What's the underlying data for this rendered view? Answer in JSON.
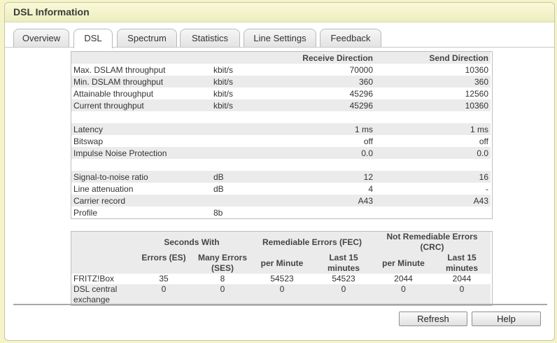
{
  "title": "DSL Information",
  "tabs": [
    "Overview",
    "DSL",
    "Spectrum",
    "Statistics",
    "Line Settings",
    "Feedback"
  ],
  "active_tab": "DSL",
  "line_table": {
    "headers": [
      "",
      "",
      "Receive Direction",
      "Send Direction"
    ],
    "rows": [
      {
        "label": "Max. DSLAM throughput",
        "unit": "kbit/s",
        "receive": "70000",
        "send": "10360"
      },
      {
        "label": "Min. DSLAM throughput",
        "unit": "kbit/s",
        "receive": "360",
        "send": "360"
      },
      {
        "label": "Attainable throughput",
        "unit": "kbit/s",
        "receive": "45296",
        "send": "12560"
      },
      {
        "label": "Current throughput",
        "unit": "kbit/s",
        "receive": "45296",
        "send": "10360"
      },
      {
        "label": "",
        "unit": "",
        "receive": "",
        "send": ""
      },
      {
        "label": "Latency",
        "unit": "",
        "receive": "1 ms",
        "send": "1 ms"
      },
      {
        "label": "Bitswap",
        "unit": "",
        "receive": "off",
        "send": "off"
      },
      {
        "label": "Impulse Noise Protection",
        "unit": "",
        "receive": "0.0",
        "send": "0.0"
      },
      {
        "label": "",
        "unit": "",
        "receive": "",
        "send": ""
      },
      {
        "label": "Signal-to-noise ratio",
        "unit": "dB",
        "receive": "12",
        "send": "16"
      },
      {
        "label": "Line attenuation",
        "unit": "dB",
        "receive": "4",
        "send": "-"
      },
      {
        "label": "Carrier record",
        "unit": "",
        "receive": "A43",
        "send": "A43"
      },
      {
        "label": "Profile",
        "unit": "8b",
        "receive": "",
        "send": ""
      }
    ]
  },
  "error_table": {
    "group_headers": [
      "Seconds With",
      "Remediable Errors (FEC)",
      "Not Remediable Errors (CRC)"
    ],
    "sub_headers": [
      "Errors (ES)",
      "Many Errors (SES)",
      "per Minute",
      "Last 15 minutes",
      "per Minute",
      "Last 15 minutes"
    ],
    "rows": [
      {
        "label": "FRITZ!Box",
        "values": [
          "35",
          "8",
          "54523",
          "54523",
          "2044",
          "2044"
        ]
      },
      {
        "label": "DSL central exchange",
        "values": [
          "0",
          "0",
          "0",
          "0",
          "0",
          "0"
        ]
      }
    ]
  },
  "buttons": {
    "refresh": "Refresh",
    "help": "Help"
  }
}
